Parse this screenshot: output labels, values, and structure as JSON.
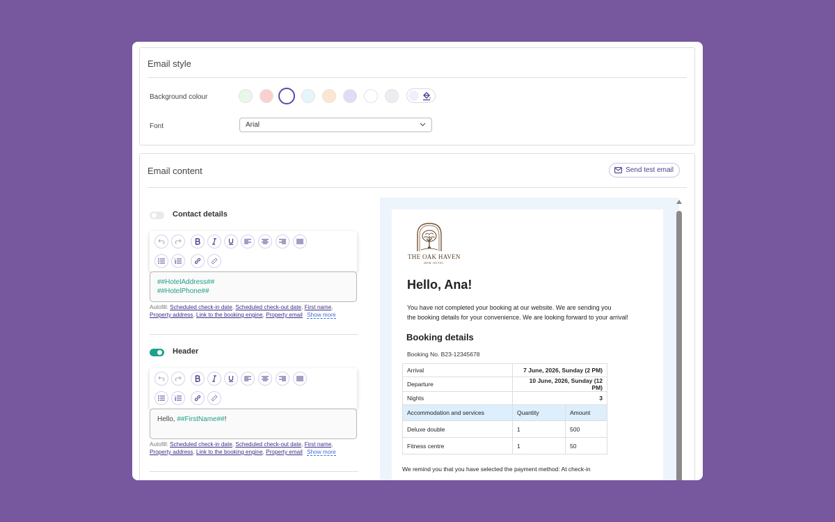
{
  "email_style": {
    "title": "Email style",
    "background_label": "Background colour",
    "swatches": [
      "#e9f7e8",
      "#fbcfd0",
      "#ffffff",
      "#e3f6fb",
      "#fde6cf",
      "#e1dbf5",
      "#ffffff",
      "#ecedf0"
    ],
    "selected_swatch": 2,
    "font_label": "Font",
    "font_value": "Arial"
  },
  "email_content": {
    "title": "Email content",
    "send_test_label": "Send test email",
    "contact": {
      "title": "Contact details",
      "enabled": false,
      "line1": "##HotelAddress##",
      "line2": "##HotelPhone##"
    },
    "header": {
      "title": "Header",
      "enabled": true,
      "prefix": "Hello, ",
      "tag": "##FirstName##",
      "suffix": "!"
    },
    "autofill": {
      "prefix": "Autofill:",
      "links": [
        "Scheduled check-in date",
        "Scheduled check-out date",
        "First name",
        "Property address",
        "Link to the booking engine",
        "Property email"
      ],
      "show_more": "Show more"
    }
  },
  "preview": {
    "logo_name": "THE OAK HAVEN",
    "logo_sub": "NEW HOTEL",
    "greeting": "Hello, Ana!",
    "intro_line1": "You have not completed your booking at our website. We are sending you",
    "intro_line2": "the booking details for your convenience. We are looking forward to your arrival!",
    "booking_heading": "Booking details",
    "booking_no": "Booking No. B23-12345678",
    "arrival_label": "Arrival",
    "arrival_value": "7 June, 2026, Sunday (2 PM)",
    "departure_label": "Departure",
    "departure_value": "10 June, 2026, Sunday (12 PM)",
    "nights_label": "Nights",
    "nights_value": "3",
    "col_service": "Accommodation and services",
    "col_quantity": "Quantity",
    "col_amount": "Amount",
    "items": [
      {
        "name": "Deluxe double",
        "qty": "1",
        "amount": "500"
      },
      {
        "name": "Fitness centre",
        "qty": "1",
        "amount": "50"
      }
    ],
    "reminder": "We remind you that you have selected the payment method: At check-in"
  }
}
